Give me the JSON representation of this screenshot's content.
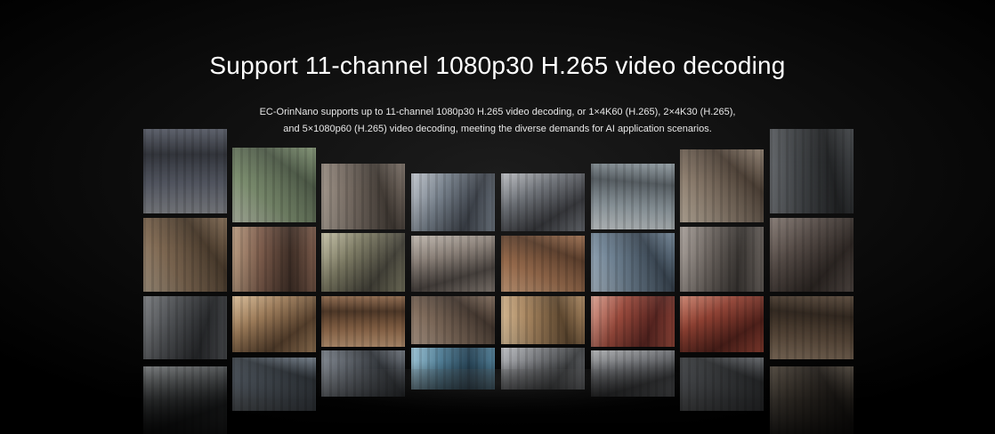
{
  "header": {
    "title": "Support 11-channel 1080p30 H.265 video decoding",
    "description_line1": "EC-OrinNano supports up to 11-channel 1080p30 H.265 video decoding, or 1×4K60 (H.265), 2×4K30 (H.265),",
    "description_line2": "and 5×1080p60 (H.265) video decoding, meeting the diverse demands for AI application scenarios."
  },
  "video_wall": {
    "columns": 8,
    "rows": 4,
    "tiles": [
      [
        "highway-traffic",
        "road-traffic",
        "city-road",
        "traffic-jam",
        "traffic-cars",
        "shopping-mall",
        "escalator-mall",
        "parking-garage"
      ],
      [
        "mall-atrium",
        "supermarket",
        "store-aisle",
        "crowded-hall",
        "metro-station",
        "street-pedestrians",
        "shop-interior",
        "retail-shelves"
      ],
      [
        "parking-lot",
        "store-display",
        "restaurant",
        "plaza-crowd",
        "lobby-interior",
        "red-showroom",
        "red-store",
        "restaurant-entrance"
      ],
      [
        "road-camera",
        "city-street",
        "building-lobby",
        "pool-area",
        "cafeteria",
        "office-hall",
        "indoor-parking",
        "warehouse"
      ]
    ],
    "palettes": {
      "highway-traffic": [
        "#6d7280",
        "#3c3f47",
        "#a9acb3"
      ],
      "road-traffic": [
        "#7d8f70",
        "#4e5a48",
        "#bcc4b0"
      ],
      "city-road": [
        "#7a6f66",
        "#433c36",
        "#b3a89c"
      ],
      "traffic-jam": [
        "#77818c",
        "#3e434b",
        "#c0c5cc"
      ],
      "traffic-cars": [
        "#6e7278",
        "#38393d",
        "#b9bbbf"
      ],
      "shopping-mall": [
        "#8f9aa0",
        "#52595e",
        "#d0d6d8"
      ],
      "escalator-mall": [
        "#8a7b6c",
        "#4c4036",
        "#c8baa8"
      ],
      "parking-garage": [
        "#55595d",
        "#2c2e30",
        "#8e9297"
      ],
      "mall-atrium": [
        "#a08468",
        "#5c4a38",
        "#d8c3a8"
      ],
      "supermarket": [
        "#7a5a4a",
        "#3e2e26",
        "#b99b80"
      ],
      "store-aisle": [
        "#7d7b64",
        "#45433a",
        "#c3bfa5"
      ],
      "crowded-hall": [
        "#8a8078",
        "#4a4440",
        "#bdb5ac"
      ],
      "metro-station": [
        "#9a6d4e",
        "#5a3e2c",
        "#d3a580"
      ],
      "street-pedestrians": [
        "#6f8293",
        "#3b4753",
        "#b2c2d0"
      ],
      "shop-interior": [
        "#6c6560",
        "#3a3633",
        "#a8a09a"
      ],
      "retail-shelves": [
        "#6a5e58",
        "#38302c",
        "#a69890"
      ],
      "parking-lot": [
        "#5f6266",
        "#303235",
        "#999ca0"
      ],
      "store-display": [
        "#9b7a58",
        "#553f2c",
        "#d6b994"
      ],
      "restaurant": [
        "#8a6548",
        "#4a3424",
        "#c49c78"
      ],
      "plaza-crowd": [
        "#7e6a5a",
        "#443830",
        "#b8a290"
      ],
      "lobby-interior": [
        "#a88660",
        "#5e4830",
        "#e0c6a0"
      ],
      "red-showroom": [
        "#9a4a3c",
        "#562420",
        "#d8a090"
      ],
      "red-store": [
        "#8e4032",
        "#4e201a",
        "#c8806c"
      ],
      "restaurant-entrance": [
        "#6e5a48",
        "#3a2e24",
        "#a89078"
      ],
      "road-camera": [
        "#6a6e70",
        "#35383a",
        "#a2a6a8"
      ],
      "city-street": [
        "#6b7580",
        "#363c42",
        "#a9b2bb"
      ],
      "building-lobby": [
        "#6a7078",
        "#33373c",
        "#a4aab2"
      ],
      "pool-area": [
        "#4f7c94",
        "#284456",
        "#98c0d2"
      ],
      "cafeteria": [
        "#7a7c80",
        "#3e4042",
        "#babcc0"
      ],
      "office-hall": [
        "#6e7074",
        "#37383a",
        "#aaacae"
      ],
      "indoor-parking": [
        "#5d6064",
        "#2f3133",
        "#96999c"
      ],
      "warehouse": [
        "#6a5f52",
        "#36302a",
        "#a5998a"
      ]
    }
  }
}
